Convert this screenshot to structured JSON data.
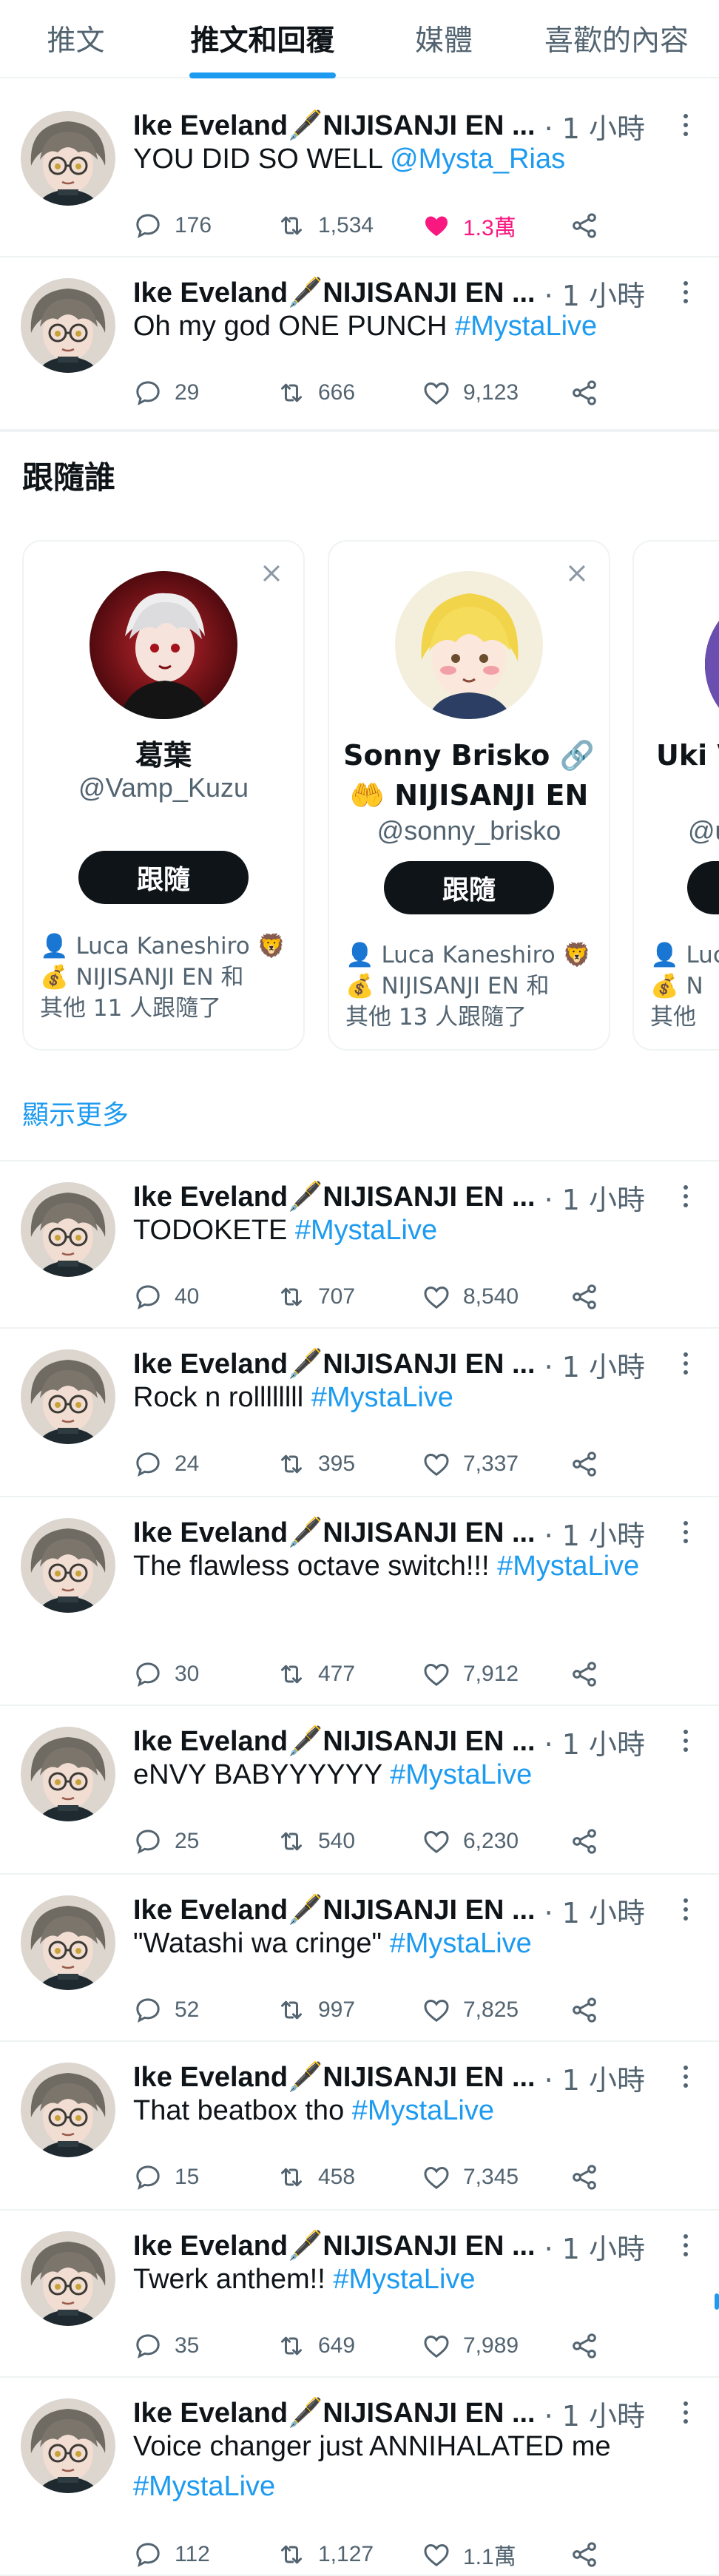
{
  "tabs": [
    "推文",
    "推文和回覆",
    "媒體",
    "喜歡的內容"
  ],
  "active_tab": 1,
  "colors": {
    "accent": "#1d9bf0",
    "like": "#f91880",
    "text": "#0f1419",
    "muted": "#536471"
  },
  "author": "Ike Eveland🖋️NIJISANJI EN ...",
  "time": "· 1 小時",
  "tweets": [
    {
      "text": "YOU DID SO WELL ",
      "tag": "@Mysta_Rias",
      "replies": "176",
      "retweets": "1,534",
      "likes": "1.3萬",
      "liked": true
    },
    {
      "text": "Oh my god ONE PUNCH ",
      "tag": "#MystaLive",
      "replies": "29",
      "retweets": "666",
      "likes": "9,123",
      "liked": false
    },
    {
      "text": "TODOKETE ",
      "tag": "#MystaLive",
      "replies": "40",
      "retweets": "707",
      "likes": "8,540",
      "liked": false
    },
    {
      "text": "Rock n rollllllll ",
      "tag": "#MystaLive",
      "replies": "24",
      "retweets": "395",
      "likes": "7,337",
      "liked": false
    },
    {
      "text": "The flawless octave switch!!! ",
      "tag": "#MystaLive",
      "replies": "30",
      "retweets": "477",
      "likes": "7,912",
      "liked": false
    },
    {
      "text": "eNVY BABYYYYYY ",
      "tag": "#MystaLive",
      "replies": "25",
      "retweets": "540",
      "likes": "6,230",
      "liked": false
    },
    {
      "text": "\"Watashi wa cringe\" ",
      "tag": "#MystaLive",
      "replies": "52",
      "retweets": "997",
      "likes": "7,825",
      "liked": false
    },
    {
      "text": "That beatbox tho ",
      "tag": "#MystaLive",
      "replies": "15",
      "retweets": "458",
      "likes": "7,345",
      "liked": false
    },
    {
      "text": "Twerk anthem!! ",
      "tag": "#MystaLive",
      "replies": "35",
      "retweets": "649",
      "likes": "7,989",
      "liked": false
    },
    {
      "text": "Voice changer just ANNIHALATED me ",
      "tag": "#MystaLive",
      "replies": "112",
      "retweets": "1,127",
      "likes": "1.1萬",
      "liked": false
    }
  ],
  "who_to_follow": {
    "title": "跟隨誰",
    "follow_label": "跟隨",
    "show_more": "顯示更多",
    "cards": [
      {
        "name": "葛葉",
        "handle": "@Vamp_Kuzu",
        "ctx": [
          "👤 Luca Kaneshiro 🦁",
          "💰 NIJISANJI EN 和",
          "其他 11 人跟隨了"
        ]
      },
      {
        "name": "Sonny Brisko 🔗 🤲 NIJISANJI EN",
        "handle": "@sonny_brisko",
        "ctx": [
          "👤 Luca Kaneshiro 🦁",
          "💰 NIJISANJI EN 和",
          "其他 13 人跟隨了"
        ]
      },
      {
        "name": "Uki V NIJ",
        "handle": "@u",
        "ctx": [
          "👤 Luc",
          "💰 N",
          "其他"
        ]
      }
    ]
  }
}
